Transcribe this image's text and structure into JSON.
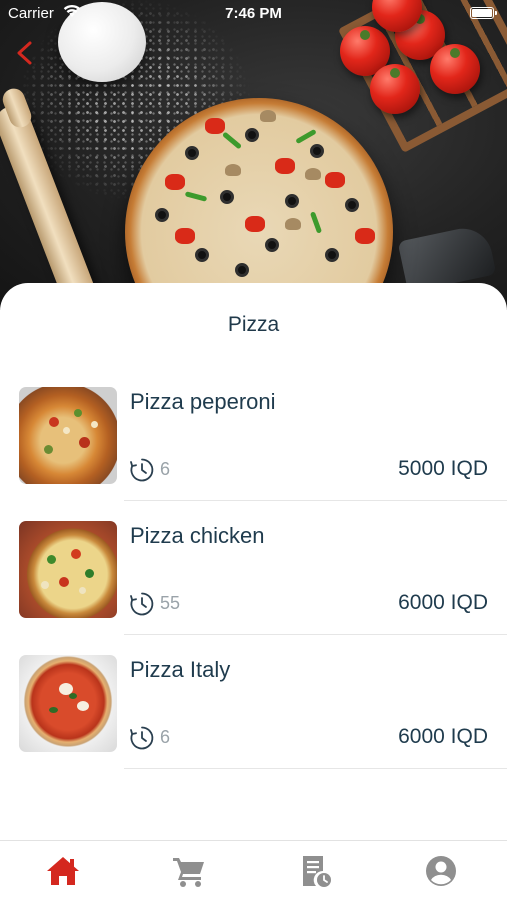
{
  "status_bar": {
    "carrier": "Carrier",
    "time": "7:46 PM",
    "battery_level": 1.0
  },
  "header": {
    "back_icon": "chevron-left-icon",
    "accent_color": "#d4281f"
  },
  "page": {
    "title": "Pizza"
  },
  "items": [
    {
      "name": "Pizza peperoni",
      "time": "6",
      "price": "5000 IQD",
      "time_icon": "timer-icon"
    },
    {
      "name": "Pizza chicken",
      "time": "55",
      "price": "6000 IQD",
      "time_icon": "timer-icon"
    },
    {
      "name": "Pizza Italy",
      "time": "6",
      "price": "6000 IQD",
      "time_icon": "timer-icon"
    }
  ],
  "tab_bar": {
    "active_color": "#d4281f",
    "inactive_color": "#8f8f8f",
    "tabs": [
      {
        "icon": "home-icon",
        "active": true
      },
      {
        "icon": "cart-icon",
        "active": false
      },
      {
        "icon": "orders-icon",
        "active": false
      },
      {
        "icon": "profile-icon",
        "active": false
      }
    ]
  }
}
